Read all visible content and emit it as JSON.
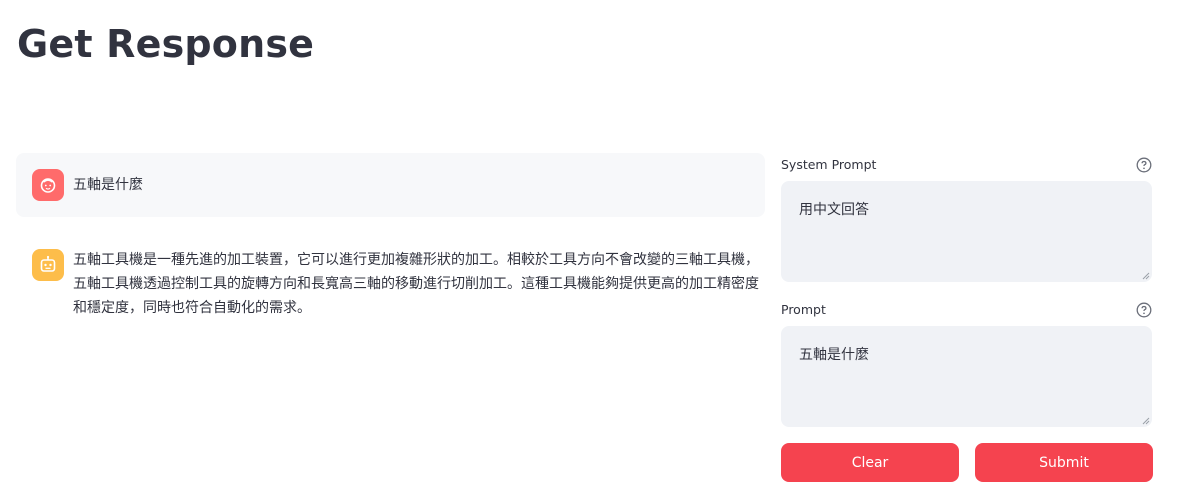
{
  "header": {
    "title": "Get Response"
  },
  "chat": {
    "messages": [
      {
        "role": "user",
        "avatar_icon": "user-face-icon",
        "text": "五軸是什麼"
      },
      {
        "role": "assistant",
        "avatar_icon": "robot-icon",
        "text": "五軸工具機是一種先進的加工裝置，它可以進行更加複雜形狀的加工。相較於工具方向不會改變的三軸工具機，五軸工具機透過控制工具的旋轉方向和長寬高三軸的移動進行切削加工。這種工具機能夠提供更高的加工精密度和穩定度，同時也符合自動化的需求。"
      }
    ]
  },
  "form": {
    "system_prompt": {
      "label": "System Prompt",
      "value": "用中文回答"
    },
    "prompt": {
      "label": "Prompt",
      "value": "五軸是什麼"
    },
    "clear_label": "Clear",
    "submit_label": "Submit"
  },
  "colors": {
    "accent": "#f5434f",
    "user_avatar": "#ff6b6b",
    "bot_avatar": "#fdbd4a",
    "input_bg": "#f0f2f6",
    "user_msg_bg": "#f7f8fa"
  }
}
